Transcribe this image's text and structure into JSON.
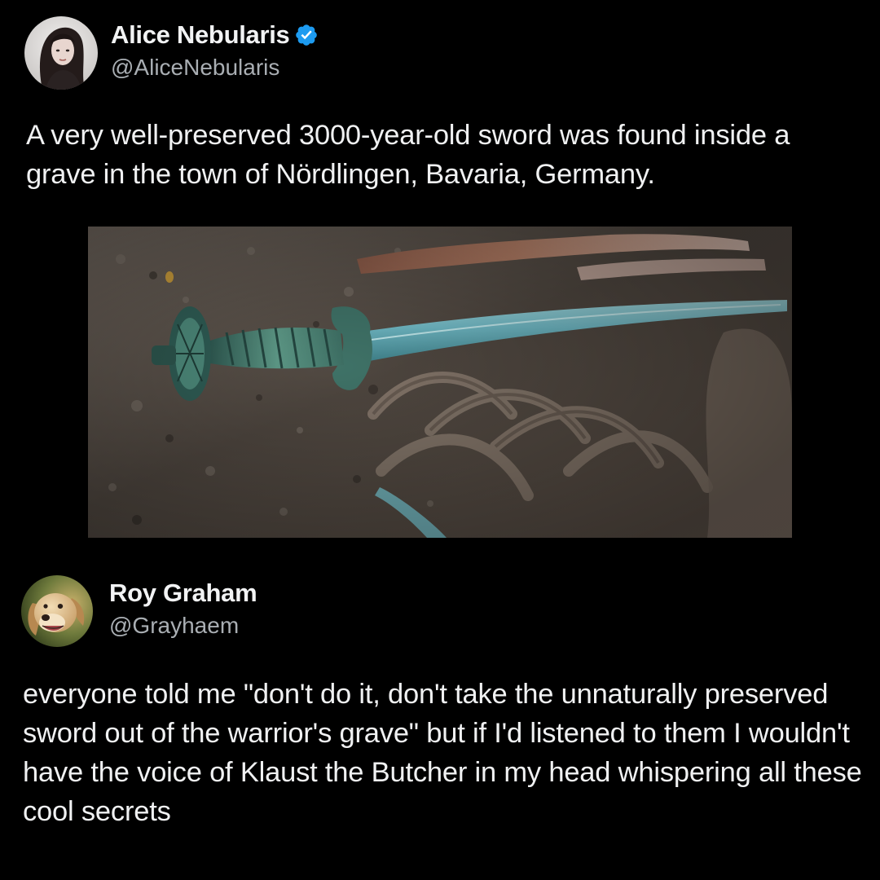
{
  "tweets": [
    {
      "author": {
        "display_name": "Alice Nebularis",
        "handle": "@AliceNebularis",
        "verified": true,
        "avatar_icon": "woman-portrait-avatar"
      },
      "text": "A very well-preserved 3000-year-old sword was found inside a grave in the town of Nördlingen, Bavaria, Germany.",
      "media": {
        "type": "photo",
        "subject": "bronze-sword-in-grave-photo"
      }
    },
    {
      "author": {
        "display_name": "Roy Graham",
        "handle": "@Grayhaem",
        "verified": false,
        "avatar_icon": "golden-retriever-avatar"
      },
      "text": "everyone told me \"don't do it, don't take the unnaturally preserved sword out of the warrior's grave\" but if I'd listened to them I wouldn't have the voice of Klaust the Butcher in my head whispering all these cool secrets"
    }
  ],
  "colors": {
    "background": "#000000",
    "text": "#e7e9ea",
    "secondary_text": "#a9aeb3",
    "verified_badge": "#1d9bf0"
  }
}
